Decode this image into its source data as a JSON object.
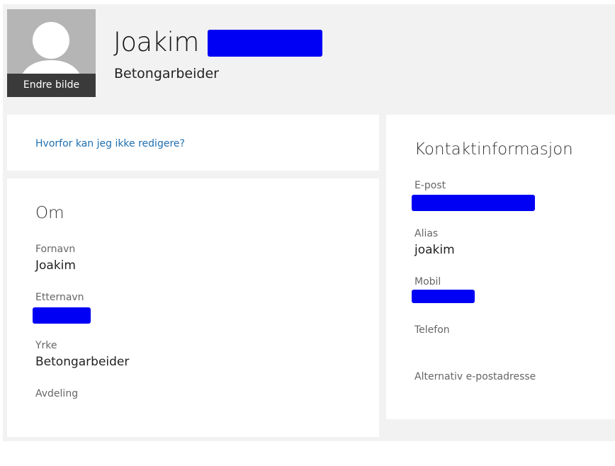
{
  "profile": {
    "first_name": "Joakim",
    "job_title": "Betongarbeider",
    "change_photo_label": "Endre bilde"
  },
  "edit_notice": {
    "link_text": "Hvorfor kan jeg ikke redigere?"
  },
  "about": {
    "title": "Om",
    "fields": [
      {
        "label": "Fornavn",
        "value": "Joakim"
      },
      {
        "label": "Etternavn",
        "value": ""
      },
      {
        "label": "Yrke",
        "value": "Betongarbeider"
      },
      {
        "label": "Avdeling",
        "value": ""
      }
    ]
  },
  "contact": {
    "title": "Kontaktinformasjon",
    "fields": [
      {
        "label": "E-post",
        "value": ""
      },
      {
        "label": "Alias",
        "value": "joakim"
      },
      {
        "label": "Mobil",
        "value": ""
      },
      {
        "label": "Telefon",
        "value": ""
      },
      {
        "label": "Alternativ e-postadresse",
        "value": ""
      }
    ]
  },
  "colors": {
    "redaction": "#0000f5",
    "link": "#1f6fb0",
    "background": "#f2f2f2"
  }
}
